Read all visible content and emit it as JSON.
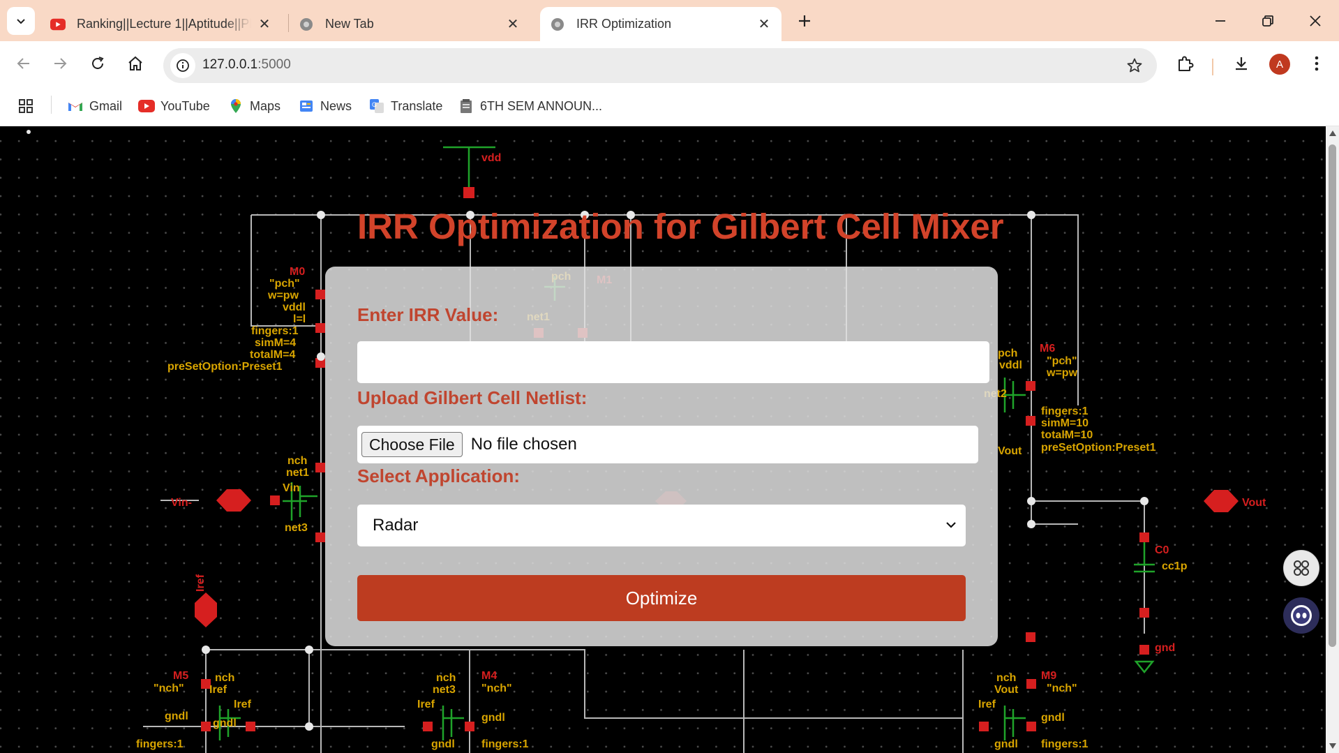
{
  "browser": {
    "tabs": [
      {
        "title": "Ranking||Lecture 1||Aptitude||Pl",
        "favicon": "youtube-icon"
      },
      {
        "title": "New Tab",
        "favicon": "globe-icon"
      },
      {
        "title": "IRR Optimization",
        "favicon": "globe-icon"
      }
    ],
    "url_host": "127.0.0.1",
    "url_port": ":5000",
    "profile_initial": "A",
    "bookmarks": [
      {
        "label": "Gmail",
        "icon": "gmail-icon"
      },
      {
        "label": "YouTube",
        "icon": "youtube-icon"
      },
      {
        "label": "Maps",
        "icon": "maps-pin-icon"
      },
      {
        "label": "News",
        "icon": "news-icon"
      },
      {
        "label": "Translate",
        "icon": "translate-icon"
      },
      {
        "label": "6TH SEM ANNOUN...",
        "icon": "document-icon"
      }
    ]
  },
  "page": {
    "title": "IRR Optimization for Gilbert Cell Mixer",
    "irr_label": "Enter IRR Value:",
    "irr_value": "",
    "netlist_label": "Upload Gilbert Cell Netlist:",
    "file_button": "Choose File",
    "file_status": "No file chosen",
    "application_label": "Select Application:",
    "application_selected": "Radar",
    "optimize_button": "Optimize"
  },
  "background_schematic": {
    "labels": [
      "vdd",
      "M0",
      "\"pch\"",
      "w=pw",
      "vddl",
      "l=l",
      "fingers:1",
      "simM=4",
      "totalM=4",
      "preSetOption:Preset1",
      "pch",
      "M1",
      "net1",
      "M6",
      "pch",
      "vddl",
      "net2",
      "Vout",
      "fingers:1",
      "simM=10",
      "totalM=10",
      "preSetOption:Preset1",
      "nch",
      "net1",
      "Vin",
      "net3",
      "Vin-",
      "Vout",
      "C0",
      "cc1p",
      "gnd",
      "nch",
      "M5",
      "Iref",
      "gndl",
      "fingers:1",
      "nch",
      "M4",
      "net3",
      "gndl",
      "fingers:1",
      "nch",
      "M9",
      "Vout",
      "Iref",
      "gndl",
      "fingers:1",
      "Iref"
    ]
  },
  "colors": {
    "chrome_bg": "#f9d9c6",
    "title_red": "#d2432a",
    "label_red": "#c0452f",
    "button_red": "#bd3c20",
    "schematic_red": "#d61f1f",
    "schematic_green": "#1fa32a",
    "schematic_yellow": "#d9a500"
  }
}
